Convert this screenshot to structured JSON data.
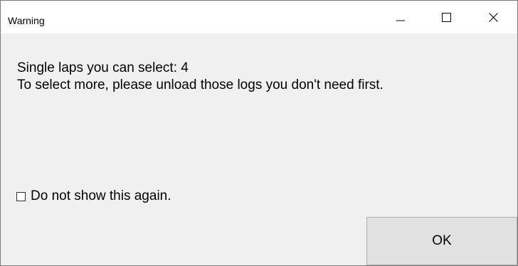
{
  "window": {
    "title": "Warning",
    "controls": {
      "minimize_icon": "minimize-icon",
      "maximize_icon": "maximize-icon",
      "close_icon": "close-icon"
    }
  },
  "message": {
    "line1": "Single laps you can select: 4",
    "line2": "To select more, please unload those logs you don't need first."
  },
  "checkbox": {
    "label": "Do not show this again.",
    "checked": false
  },
  "buttons": {
    "ok_label": "OK"
  },
  "colors": {
    "titlebar_bg": "#ffffff",
    "body_bg": "#f0f0f0",
    "button_bg": "#e1e1e1",
    "button_border": "#adadad"
  }
}
